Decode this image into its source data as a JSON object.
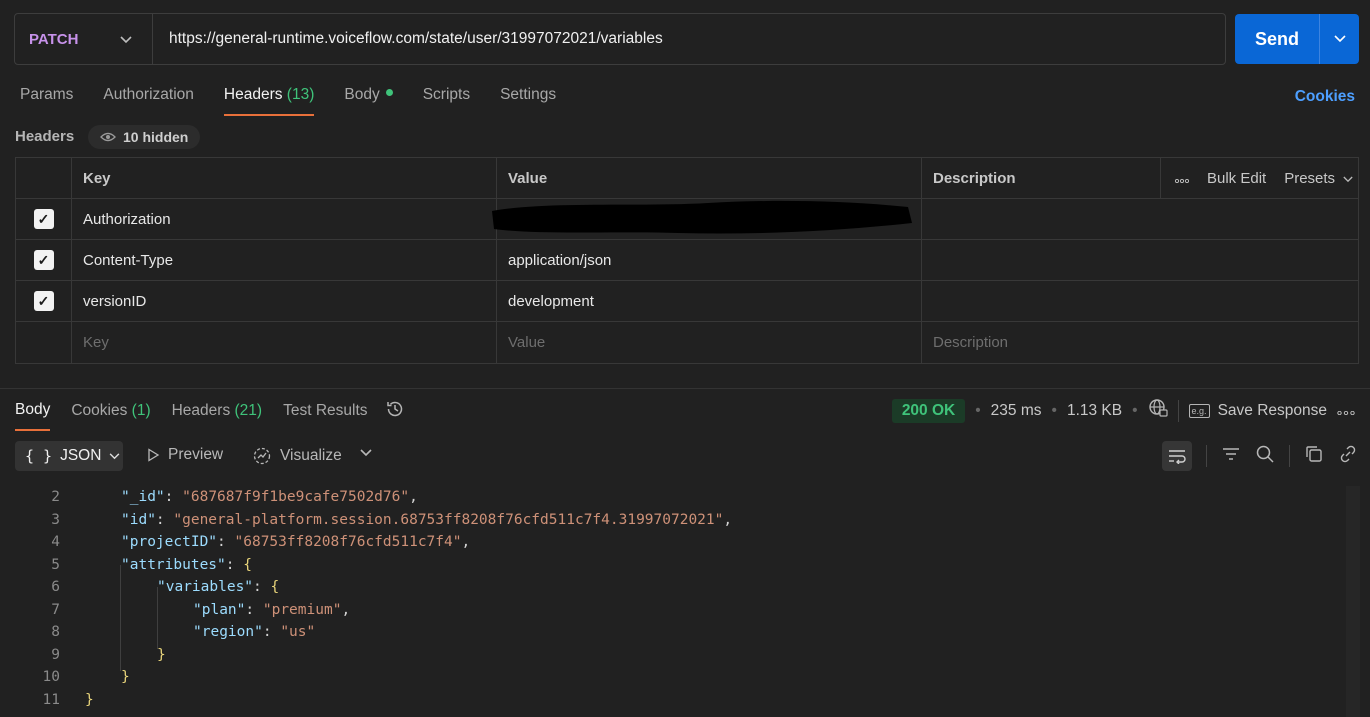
{
  "request": {
    "method": "PATCH",
    "url": "https://general-runtime.voiceflow.com/state/user/31997072021/variables",
    "send_label": "Send"
  },
  "request_tabs": [
    {
      "label": "Params"
    },
    {
      "label": "Authorization"
    },
    {
      "label": "Headers",
      "count": "(13)"
    },
    {
      "label": "Body"
    },
    {
      "label": "Scripts"
    },
    {
      "label": "Settings"
    }
  ],
  "cookies_link": "Cookies",
  "headers_section": {
    "title": "Headers",
    "hidden_label": "10 hidden",
    "columns": {
      "key": "Key",
      "value": "Value",
      "description": "Description"
    },
    "bulk_edit": "Bulk Edit",
    "presets": "Presets",
    "more_label": "∙∙∙",
    "rows": [
      {
        "key": "Authorization",
        "value": "",
        "checked": true
      },
      {
        "key": "Content-Type",
        "value": "application/json",
        "checked": true
      },
      {
        "key": "versionID",
        "value": "development",
        "checked": true
      }
    ],
    "placeholders": {
      "key": "Key",
      "value": "Value",
      "description": "Description"
    }
  },
  "response_tabs": [
    {
      "label": "Body"
    },
    {
      "label": "Cookies",
      "count": "(1)"
    },
    {
      "label": "Headers",
      "count": "(21)"
    },
    {
      "label": "Test Results"
    }
  ],
  "response_status": {
    "status": "200 OK",
    "time": "235 ms",
    "size": "1.13 KB",
    "save_label": "Save Response",
    "eg_label": "e.g."
  },
  "response_toolbar": {
    "format": "JSON",
    "preview": "Preview",
    "visualize": "Visualize"
  },
  "code_lines": [
    {
      "n": "2",
      "key": "\"_id\"",
      "value": "\"687687f9f1be9cafe7502d76\"",
      "tail": ","
    },
    {
      "n": "3",
      "key": "\"id\"",
      "value": "\"general-platform.session.68753ff8208f76cfd511c7f4.31997072021\"",
      "tail": ","
    },
    {
      "n": "4",
      "key": "\"projectID\"",
      "value": "\"68753ff8208f76cfd511c7f4\"",
      "tail": ","
    },
    {
      "n": "5",
      "key": "\"attributes\"",
      "value": "",
      "tail": "{"
    },
    {
      "n": "6",
      "key": "\"variables\"",
      "value": "",
      "tail": "{"
    },
    {
      "n": "7",
      "key": "\"plan\"",
      "value": "\"premium\"",
      "tail": ","
    },
    {
      "n": "8",
      "key": "\"region\"",
      "value": "\"us\"",
      "tail": ""
    },
    {
      "n": "9",
      "key": "",
      "value": "",
      "tail": "}"
    },
    {
      "n": "10",
      "key": "",
      "value": "",
      "tail": "}"
    },
    {
      "n": "11",
      "key": "",
      "value": "",
      "tail": "}"
    }
  ],
  "colors": {
    "accent": "#0a67d6",
    "tab_underline": "#e8703a",
    "success": "#3fc37a",
    "method": "#c792ea"
  }
}
